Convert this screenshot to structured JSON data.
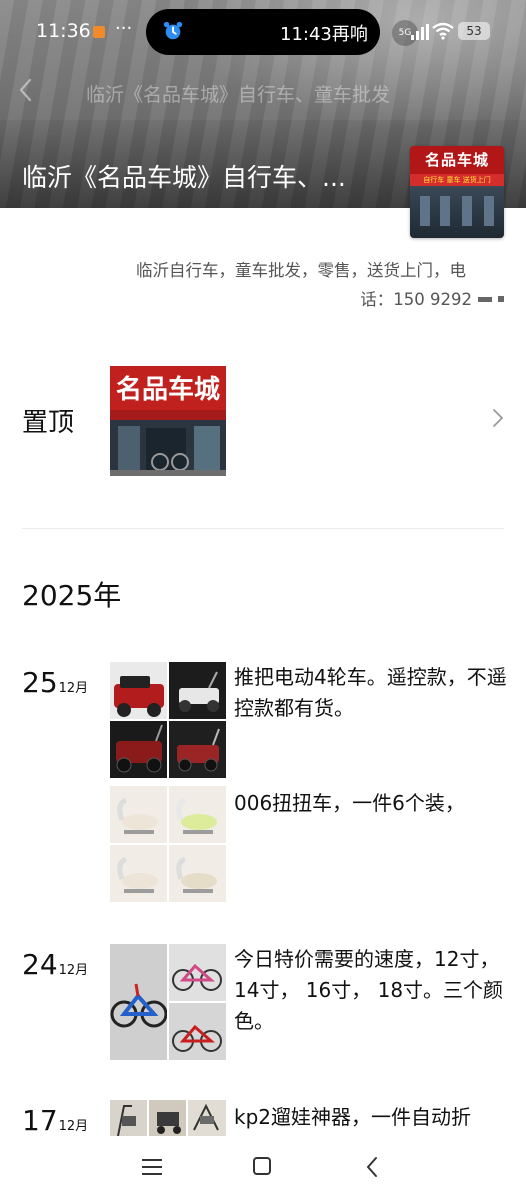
{
  "status_bar": {
    "time": "11:36",
    "more": "···",
    "island_text": "11:43再响",
    "network": "5G",
    "battery": "53"
  },
  "nav": {
    "title": "临沂《名品车城》自行车、童车批发"
  },
  "profile": {
    "name": "临沂《名品车城》自行车、...",
    "avatar_sign": "名品车城",
    "avatar_sub": "自行车  童车  送货上门",
    "description_line1": "临沂自行车，童车批发，零售，送货上门，电",
    "description_line2": "话：150 9292"
  },
  "pinned": {
    "label": "置顶",
    "thumb_sign": "名品车城"
  },
  "year_header": "2025年",
  "posts": [
    {
      "day": "25",
      "month": "12月",
      "entries": [
        {
          "text": "推把电动4轮车。遥控款，不遥控款都有货。"
        },
        {
          "text": "006扭扭车，一件6个装，"
        }
      ]
    },
    {
      "day": "24",
      "month": "12月",
      "entries": [
        {
          "text": "今日特价需要的速度，12寸，14寸， 16寸， 18寸。三个颜色。"
        }
      ]
    },
    {
      "day": "17",
      "month": "12月",
      "entries": [
        {
          "text": "kp2遛娃神器，一件自动折"
        }
      ]
    }
  ],
  "colors": {
    "sign_red": "#c51c1c",
    "text_primary": "#111111",
    "text_secondary": "#555555",
    "divider": "#ececec"
  }
}
